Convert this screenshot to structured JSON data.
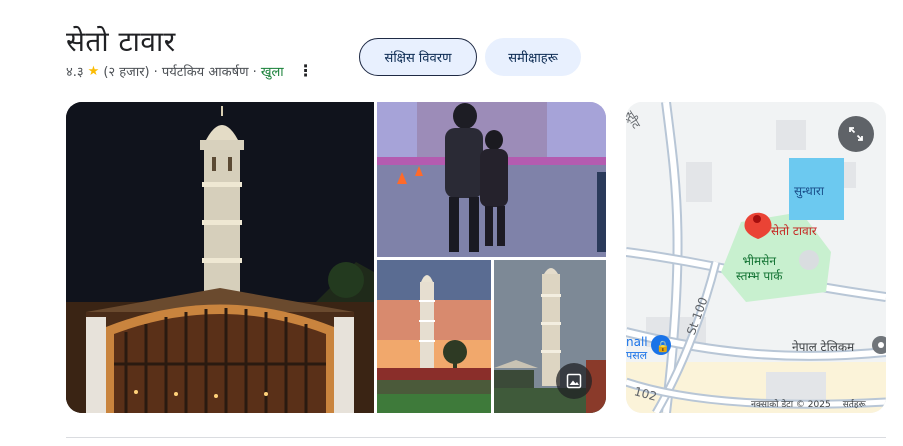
{
  "place": {
    "title": "सेतो टावार",
    "rating": "४.३",
    "review_count": "(२ हजार)",
    "category": "· पर्यटकिय आकर्षण ·",
    "status": "खुला"
  },
  "tabs": [
    {
      "label": "संक्षिस विवरण",
      "selected": true
    },
    {
      "label": "समीक्षाहरू",
      "selected": false
    }
  ],
  "gallery": {
    "gallery_icon": "image-gallery-icon"
  },
  "map": {
    "labels": {
      "marker": "सेतो टावार",
      "sundhara": "सुन्धारा",
      "park": "भीमसेन\nस्तम्भ पार्क",
      "ntc": "नेपाल टेलिकम",
      "street_top": "स्ट्रीट",
      "road_100": "St 100",
      "road_102": "102",
      "nall": "nall",
      "nall_sub": "पसल"
    },
    "attribution": "नक्साको डेटा © 2025",
    "terms": "सर्तहरू",
    "expand_icon": "expand-icon"
  },
  "colors": {
    "accent": "#0b57d0",
    "open": "#188038",
    "star": "#fbbc04",
    "tab_bg": "#e8f0fe",
    "marker": "#ea4335",
    "park": "#c8f0cf",
    "water": "#6cc9f0"
  }
}
